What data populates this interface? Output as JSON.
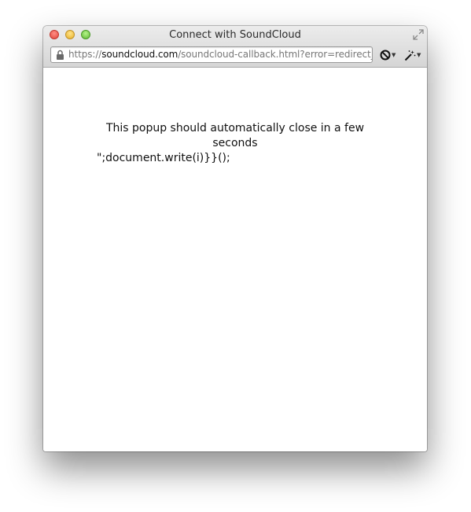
{
  "window": {
    "title": "Connect with SoundCloud"
  },
  "address_bar": {
    "scheme": "https://",
    "host": "soundcloud.com",
    "path": "/soundcloud-callback.html?error=redirect_",
    "secure_icon": "lock-icon"
  },
  "toolbar": {
    "block_icon": "no-entry-icon",
    "extension_icon": "magic-wand-icon"
  },
  "page": {
    "message": "This popup should automatically close in a few seconds",
    "script_text": "\";document.write(i)}}();"
  },
  "colors": {
    "close": "#e0443a",
    "minimize": "#e7b027",
    "zoom": "#5fb534",
    "host_text": "#111111",
    "url_text": "#777777"
  }
}
